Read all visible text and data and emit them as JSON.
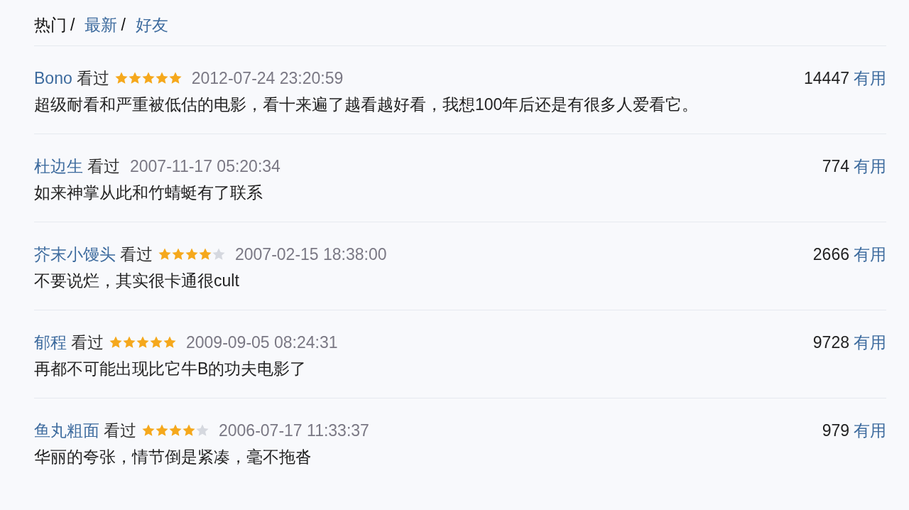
{
  "tabs": [
    {
      "label": "热门",
      "selected": true,
      "separator": "/"
    },
    {
      "label": "最新",
      "selected": false,
      "separator": "/"
    },
    {
      "label": "好友",
      "selected": false
    }
  ],
  "reviews": [
    {
      "user": "Bono",
      "status": "看过",
      "stars": 5,
      "time": "2012-07-24 23:20:59",
      "useful_count": "14447",
      "useful_label": "有用",
      "comment": "超级耐看和严重被低估的电影，看十来遍了越看越好看，我想100年后还是有很多人爱看它。"
    },
    {
      "user": "杜边生",
      "status": "看过",
      "time": "2007-11-17 05:20:34",
      "useful_count": "774",
      "useful_label": "有用",
      "comment": "如来神掌从此和竹蜻蜓有了联系"
    },
    {
      "user": "芥末小馒头",
      "status": "看过",
      "stars": 4,
      "time": "2007-02-15 18:38:00",
      "useful_count": "2666",
      "useful_label": "有用",
      "comment": "不要说烂，其实很卡通很cult"
    },
    {
      "user": "郁程",
      "status": "看过",
      "stars": 5,
      "time": "2009-09-05 08:24:31",
      "useful_count": "9728",
      "useful_label": "有用",
      "comment": "再都不可能出现比它牛B的功夫电影了"
    },
    {
      "user": "鱼丸粗面",
      "status": "看过",
      "stars": 4,
      "time": "2006-07-17 11:33:37",
      "useful_count": "979",
      "useful_label": "有用",
      "comment": "华丽的夸张，情节倒是紧凑，毫不拖沓"
    }
  ]
}
